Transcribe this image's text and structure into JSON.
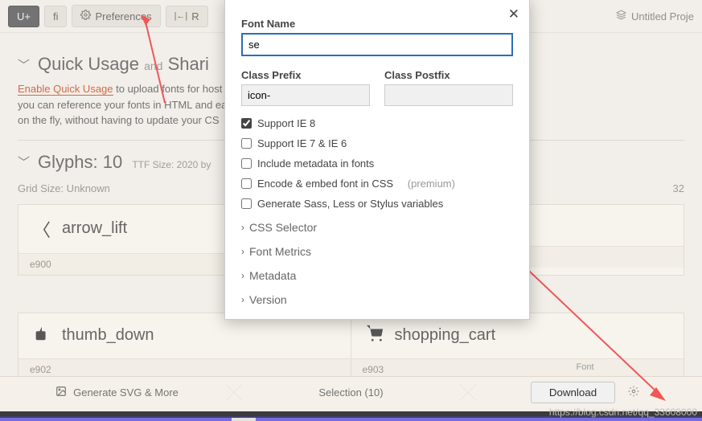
{
  "toolbar": {
    "btn1": "U+",
    "btn2": "fi",
    "pref": "Preferences",
    "reset": "R",
    "project": "Untitled Proje"
  },
  "quick": {
    "title": "Quick Usage",
    "and": "and",
    "sharing": "Shari",
    "link": "Enable Quick Usage",
    "text1": " to upload fonts for host",
    "text2": "you can reference your fonts in HTML and ea",
    "text3": "on the fly, without having to update your CS"
  },
  "glyphs_head": {
    "title": "Glyphs: 10",
    "ttf": "TTF Size: 2020 by"
  },
  "grid": {
    "label": "Grid Size: Unknown",
    "count": "32"
  },
  "glyphs": [
    {
      "name": "arrow_lift",
      "code": "e900"
    },
    {
      "name": "thumb_down",
      "code": "e902"
    },
    {
      "name": "shopping_cart",
      "code": "e903"
    }
  ],
  "footer": {
    "gen": "Generate SVG & More",
    "sel": "Selection (10)",
    "font_label": "Font",
    "download": "Download"
  },
  "modal": {
    "font_name_label": "Font Name",
    "font_name_value": "se",
    "prefix_label": "Class Prefix",
    "prefix_value": "icon-",
    "postfix_label": "Class Postfix",
    "postfix_value": "",
    "checks": {
      "ie8": "Support IE 8",
      "ie76": "Support IE 7 & IE 6",
      "meta": "Include metadata in fonts",
      "embed": "Encode & embed font in CSS",
      "premium": "(premium)",
      "sass": "Generate Sass, Less or Stylus variables"
    },
    "expand": {
      "css": "CSS Selector",
      "metrics": "Font Metrics",
      "metadata": "Metadata",
      "version": "Version"
    }
  },
  "watermark": "https://blog.csdn.net/qq_33608000"
}
